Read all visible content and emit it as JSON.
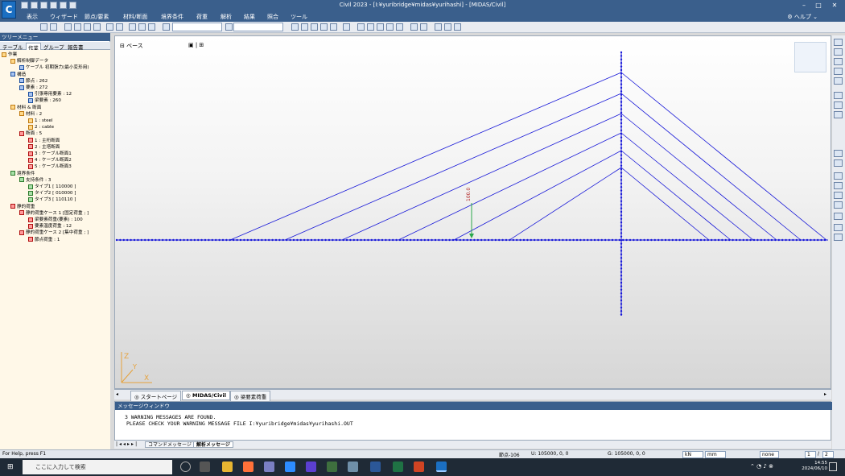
{
  "window": {
    "title": "Civil 2023 - [I:¥yuribridge¥midas¥yurihashi] - [MIDAS/Civil]",
    "logo": "C"
  },
  "menu": [
    "表示",
    "ウィザード",
    "節点/要素",
    "材料/断面",
    "境界条件",
    "荷重",
    "解析",
    "結果",
    "照合",
    "ツール"
  ],
  "help_label": "ヘルプ",
  "tree": {
    "header": "ツリーメニュー",
    "tabs": [
      "テーブル",
      "作業",
      "グループ",
      "報告書"
    ],
    "active_tab": "作業",
    "items": [
      {
        "text": "作業",
        "indent": 0,
        "icon": "folder-icon"
      },
      {
        "text": "解析制御データ",
        "indent": 1,
        "icon": "settings-icon"
      },
      {
        "text": "ケーブル 初期張力(最小変形用)",
        "indent": 2,
        "icon": "cable-icon"
      },
      {
        "text": "構造",
        "indent": 1,
        "icon": "structure-icon"
      },
      {
        "text": "節点 : 262",
        "indent": 2,
        "icon": "node-icon"
      },
      {
        "text": "要素 : 272",
        "indent": 2,
        "icon": "element-icon"
      },
      {
        "text": "引張専用要素 : 12",
        "indent": 3,
        "icon": "truss-icon"
      },
      {
        "text": "梁要素 : 260",
        "indent": 3,
        "icon": "beam-icon"
      },
      {
        "text": "材料 & 断面",
        "indent": 1,
        "icon": "material-icon"
      },
      {
        "text": "材料 : 2",
        "indent": 2,
        "icon": "material-icon"
      },
      {
        "text": "1 : steel",
        "indent": 3,
        "icon": "material-icon"
      },
      {
        "text": "2 : cable",
        "indent": 3,
        "icon": "material-icon"
      },
      {
        "text": "断面 : 5",
        "indent": 2,
        "icon": "section-icon"
      },
      {
        "text": "1 : 主桁断面",
        "indent": 3,
        "icon": "section-icon"
      },
      {
        "text": "2 : 主塔断面",
        "indent": 3,
        "icon": "section-icon"
      },
      {
        "text": "3 : ケーブル断面1",
        "indent": 3,
        "icon": "section-icon"
      },
      {
        "text": "4 : ケーブル断面2",
        "indent": 3,
        "icon": "section-icon"
      },
      {
        "text": "5 : ケーブル断面3",
        "indent": 3,
        "icon": "section-icon"
      },
      {
        "text": "境界条件",
        "indent": 1,
        "icon": "support-icon"
      },
      {
        "text": "支持条件 : 3",
        "indent": 2,
        "icon": "support-icon"
      },
      {
        "text": "タイプ1 [ 110000 ]",
        "indent": 3,
        "icon": "support-icon"
      },
      {
        "text": "タイプ2 [ 010000 ]",
        "indent": 3,
        "icon": "support-icon"
      },
      {
        "text": "タイプ3 [ 110110 ]",
        "indent": 3,
        "icon": "support-icon"
      },
      {
        "text": "静的荷重",
        "indent": 1,
        "icon": "load-icon"
      },
      {
        "text": "静的荷重ケース 1 [固定荷重 ; ]",
        "indent": 2,
        "icon": "load-icon"
      },
      {
        "text": "梁要素荷重(要素) : 100",
        "indent": 3,
        "icon": "load-icon"
      },
      {
        "text": "要素温度荷重 : 12",
        "indent": 3,
        "icon": "load-icon"
      },
      {
        "text": "静的荷重ケース 2 [集中荷重 ; ]",
        "indent": 2,
        "icon": "load-icon"
      },
      {
        "text": "節点荷重 : 1",
        "indent": 3,
        "icon": "load-icon"
      }
    ]
  },
  "viewport": {
    "label": "ベース",
    "load_label": "100.0",
    "axis_labels": {
      "x": "X",
      "y": "Y",
      "z": "Z"
    },
    "model_color": "#1616d8"
  },
  "doc_tabs": [
    "スタートページ",
    "MIDAS/Civil",
    "梁要素荷重"
  ],
  "doc_tab_active": "MIDAS/Civil",
  "message_window": {
    "header": "メッセージウィンドウ",
    "lines": [
      "3 WARNING MESSAGES ARE FOUND.",
      "PLEASE CHECK YOUR WARNING MESSAGE FILE  I:¥yuribridge¥midas¥yurihashi.OUT"
    ]
  },
  "message_tabs": [
    "コマンドメッセージ",
    "解析メッセージ"
  ],
  "status": {
    "help": "For Help, press F1",
    "node": "節点-106",
    "u": "U: 105000, 0, 0",
    "g": "G: 105000, 0, 0",
    "force_unit": "kN",
    "length_unit": "mm",
    "none_label": "none",
    "page": "1",
    "pages": "2"
  },
  "taskbar": {
    "search_placeholder": "ここに入力して検索",
    "time": "14:55",
    "date": "2024/06/10"
  }
}
